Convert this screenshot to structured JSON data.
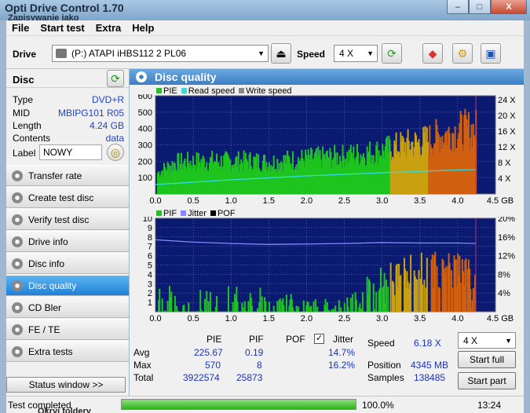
{
  "window": {
    "title": "Opti Drive Control 1.70",
    "subtitle": "Zapisywanie jako",
    "minimize": "–",
    "maximize": "□",
    "close": "X"
  },
  "menu": [
    "File",
    "Start test",
    "Extra",
    "Help"
  ],
  "toolbar": {
    "drive_label": "Drive",
    "drive_value": "(P:)   ATAPI iHBS112   2 PL06",
    "speed_label": "Speed",
    "speed_value": "4 X"
  },
  "disc": {
    "header": "Disc",
    "rows": [
      {
        "k": "Type",
        "v": "DVD+R"
      },
      {
        "k": "MID",
        "v": "MBIPG101 R05"
      },
      {
        "k": "Length",
        "v": "4.24 GB"
      },
      {
        "k": "Contents",
        "v": "data"
      }
    ],
    "label_key": "Label",
    "label_value": "NOWY"
  },
  "nav": [
    {
      "label": "Transfer rate",
      "active": false
    },
    {
      "label": "Create test disc",
      "active": false
    },
    {
      "label": "Verify test disc",
      "active": false
    },
    {
      "label": "Drive info",
      "active": false
    },
    {
      "label": "Disc info",
      "active": false
    },
    {
      "label": "Disc quality",
      "active": true
    },
    {
      "label": "CD Bler",
      "active": false
    },
    {
      "label": "FE / TE",
      "active": false
    },
    {
      "label": "Extra tests",
      "active": false
    }
  ],
  "status_window_button": "Status window >>",
  "panel_title": "Disc quality",
  "chart_data": [
    {
      "type": "bar",
      "legend": [
        "PIE",
        "Read speed",
        "Write speed"
      ],
      "x_ticks": [
        "0.0",
        "0.5",
        "1.0",
        "1.5",
        "2.0",
        "2.5",
        "3.0",
        "3.5",
        "4.0",
        "4.5 GB"
      ],
      "y_ticks": [
        "600",
        "500",
        "400",
        "300",
        "200",
        "100"
      ],
      "y2_ticks": [
        "24 X",
        "20 X",
        "16 X",
        "12 X",
        "8 X",
        "4 X"
      ],
      "ylim": [
        0,
        600
      ],
      "xlim": [
        0,
        4.5
      ],
      "series": [
        {
          "name": "PIE",
          "x": [
            0.0,
            0.25,
            0.5,
            0.75,
            1.0,
            1.25,
            1.5,
            1.75,
            2.0,
            2.25,
            2.5,
            2.75,
            3.0,
            3.25,
            3.5,
            3.75,
            4.0,
            4.24
          ],
          "y": [
            150,
            230,
            240,
            245,
            240,
            245,
            235,
            250,
            260,
            270,
            280,
            300,
            320,
            360,
            380,
            430,
            470,
            480
          ]
        },
        {
          "name": "Read speed",
          "x": [
            0.0,
            1.0,
            2.0,
            3.0,
            4.0,
            4.24
          ],
          "y": [
            2.4,
            3.6,
            4.6,
            5.4,
            6.1,
            6.2
          ]
        }
      ]
    },
    {
      "type": "bar",
      "legend": [
        "PIF",
        "Jitter",
        "POF"
      ],
      "x_ticks": [
        "0.0",
        "0.5",
        "1.0",
        "1.5",
        "2.0",
        "2.5",
        "3.0",
        "3.5",
        "4.0",
        "4.5 GB"
      ],
      "y_ticks": [
        "10",
        "9",
        "8",
        "7",
        "6",
        "5",
        "4",
        "3",
        "2",
        "1"
      ],
      "y2_ticks": [
        "20%",
        "16%",
        "12%",
        "8%",
        "4%"
      ],
      "ylim": [
        0,
        10
      ],
      "xlim": [
        0,
        4.5
      ],
      "series": [
        {
          "name": "PIF",
          "x": [
            0.0,
            0.5,
            1.0,
            1.5,
            2.0,
            2.5,
            2.8,
            3.0,
            3.5,
            4.0,
            4.24
          ],
          "y": [
            2,
            2,
            2,
            2,
            1,
            1,
            3,
            4,
            5,
            5,
            4
          ]
        },
        {
          "name": "Jitter",
          "x": [
            0.0,
            0.5,
            1.0,
            1.5,
            2.0,
            2.5,
            3.0,
            3.5,
            4.0,
            4.24
          ],
          "y": [
            15.4,
            14.9,
            14.6,
            14.4,
            14.5,
            14.6,
            14.8,
            14.7,
            14.7,
            14.6
          ]
        }
      ]
    }
  ],
  "stats": {
    "cols": [
      "PIE",
      "PIF",
      "POF",
      "Jitter"
    ],
    "rows": [
      {
        "k": "Avg",
        "pie": "225.67",
        "pif": "0.19",
        "pof": "",
        "jit": "14.7%"
      },
      {
        "k": "Max",
        "pie": "570",
        "pif": "8",
        "pof": "",
        "jit": "16.2%"
      },
      {
        "k": "Total",
        "pie": "3922574",
        "pif": "25873",
        "pof": "",
        "jit": ""
      }
    ],
    "speed_label": "Speed",
    "speed_value": "6.18 X",
    "position_label": "Position",
    "position_value": "4345 MB",
    "samples_label": "Samples",
    "samples_value": "138485",
    "speed_select": "4 X",
    "start_full": "Start full",
    "start_part": "Start part"
  },
  "statusbar": {
    "text": "Test completed",
    "progress": "100.0%",
    "progress_fraction": 1.0,
    "time": "13:24"
  },
  "behind_text": "Okryj foldery",
  "colors": {
    "pie": "#1fc41f",
    "read": "#33dddd",
    "write": "#888888",
    "pif": "#1fc41f",
    "jitter": "#8888ff",
    "pof": "#000000",
    "plot_bg": "#0a1a70",
    "accent": "#3b7fc4"
  }
}
